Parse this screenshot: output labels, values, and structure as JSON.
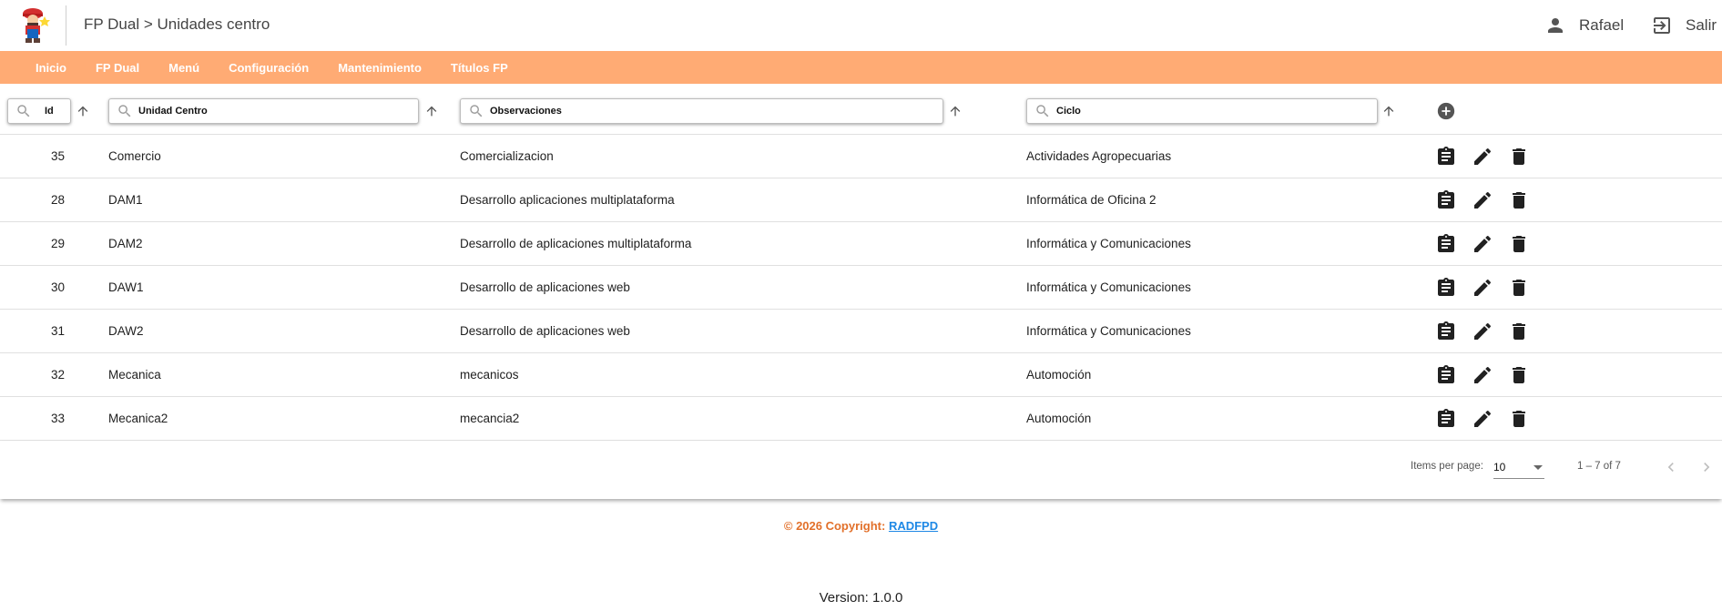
{
  "header": {
    "breadcrumb": "FP Dual > Unidades centro",
    "user_name": "Rafael",
    "logout_label": "Salir"
  },
  "nav": {
    "items": [
      "Inicio",
      "FP Dual",
      "Menú",
      "Configuración",
      "Mantenimiento",
      "Títulos FP"
    ]
  },
  "filters": {
    "id": "Id",
    "unidad_centro": "Unidad Centro",
    "observaciones": "Observaciones",
    "ciclo": "Ciclo"
  },
  "rows": [
    {
      "id": "35",
      "unidad": "Comercio",
      "obs": "Comercializacion",
      "ciclo": "Actividades Agropecuarias"
    },
    {
      "id": "28",
      "unidad": "DAM1",
      "obs": "Desarrollo aplicaciones multiplataforma",
      "ciclo": "Informática de Oficina 2"
    },
    {
      "id": "29",
      "unidad": "DAM2",
      "obs": "Desarrollo de aplicaciones multiplataforma",
      "ciclo": "Informática y Comunicaciones"
    },
    {
      "id": "30",
      "unidad": "DAW1",
      "obs": "Desarrollo de aplicaciones web",
      "ciclo": "Informática y Comunicaciones"
    },
    {
      "id": "31",
      "unidad": "DAW2",
      "obs": "Desarrollo de aplicaciones web",
      "ciclo": "Informática y Comunicaciones"
    },
    {
      "id": "32",
      "unidad": "Mecanica",
      "obs": "mecanicos",
      "ciclo": "Automoción"
    },
    {
      "id": "33",
      "unidad": "Mecanica2",
      "obs": "mecancia2",
      "ciclo": "Automoción"
    }
  ],
  "paginator": {
    "items_per_page_label": "Items per page:",
    "page_size": "10",
    "range": "1 – 7 of 7"
  },
  "footer": {
    "copyright": "© 2026 Copyright:",
    "link": "RADFPD",
    "version": "Version: 1.0.0"
  },
  "colors": {
    "nav_bg": "#ffab74",
    "footer_text": "#e2702a",
    "link": "#1e88e5"
  }
}
